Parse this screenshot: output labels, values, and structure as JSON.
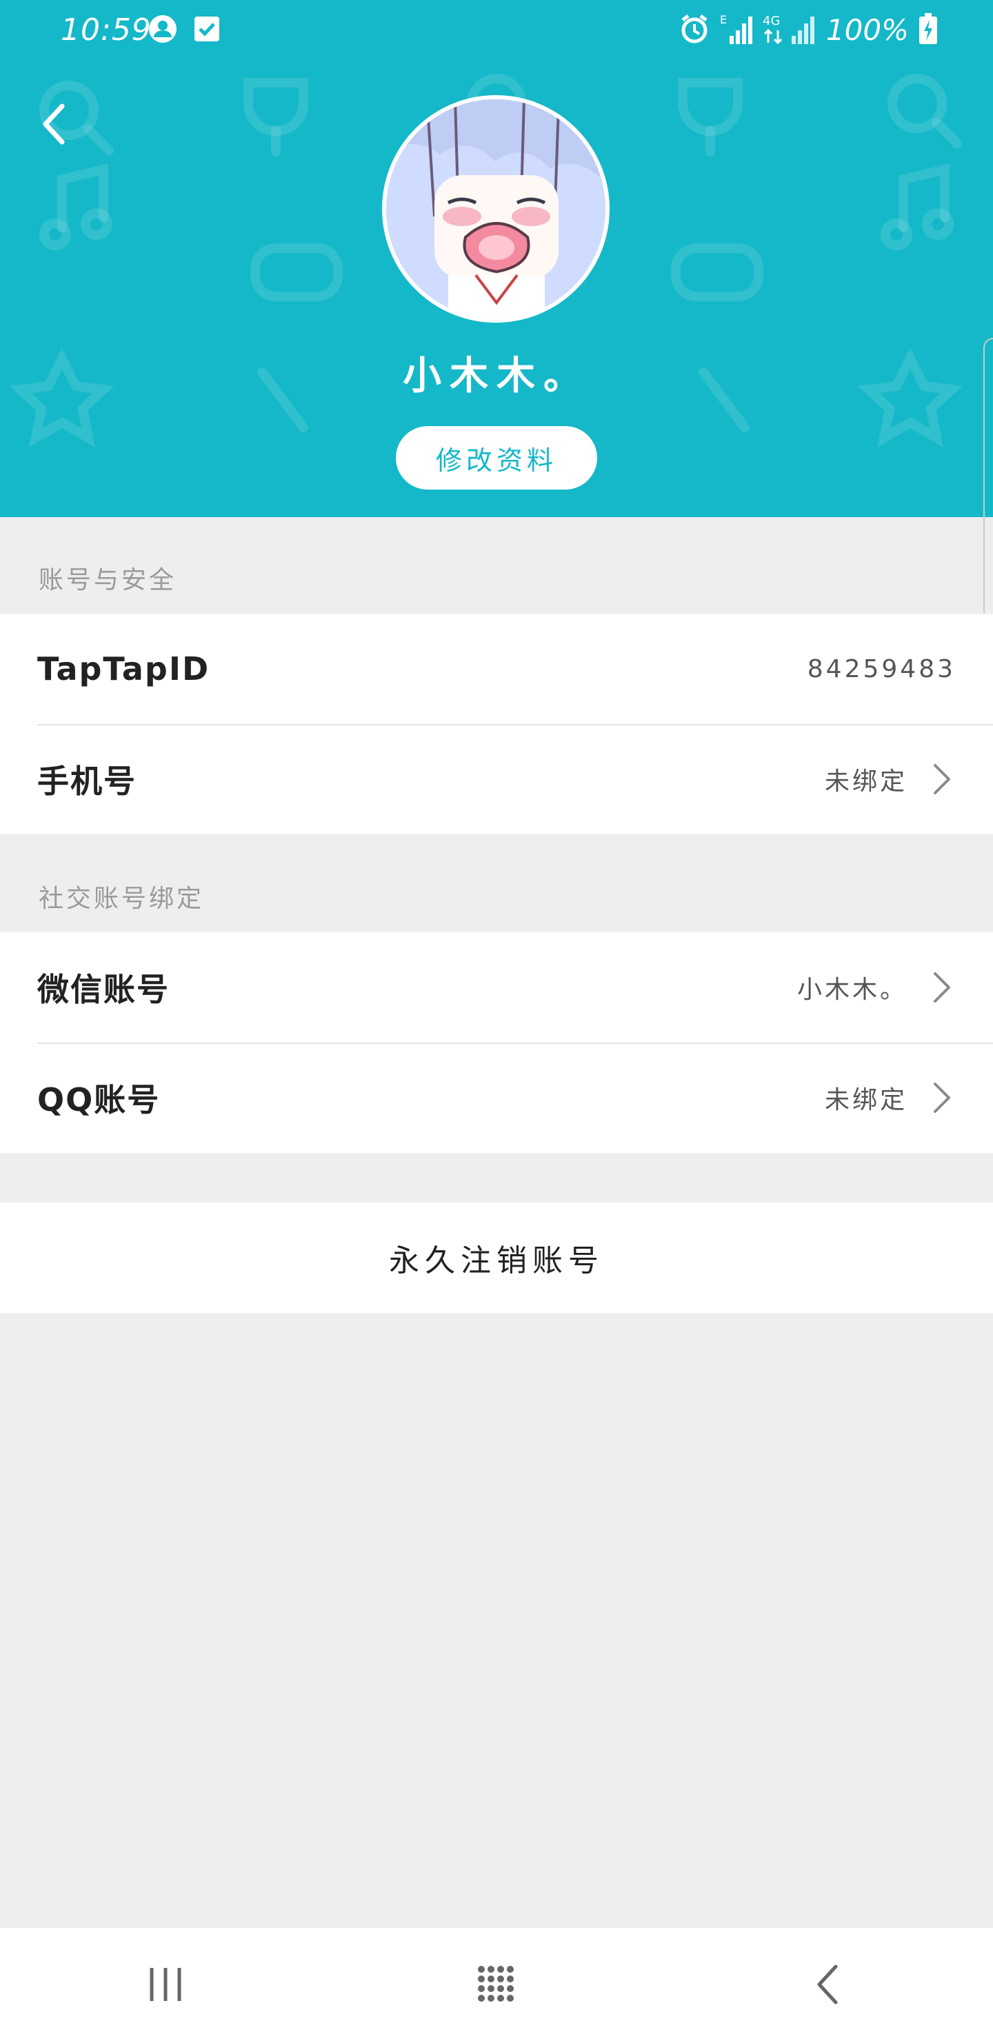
{
  "status_bar": {
    "time": "10:59",
    "battery": "100%",
    "network": "4G",
    "signal_label": "E",
    "icons": [
      "profile-icon",
      "checkbox-icon",
      "alarm-icon",
      "signal-icon",
      "battery-charging-icon"
    ]
  },
  "header": {
    "background_color": "#15b8c8",
    "nickname": "小木木。",
    "edit_button_label": "修改资料"
  },
  "sections": [
    {
      "title": "账号与安全",
      "rows": [
        {
          "label": "TapTapID",
          "value": "84259483",
          "chevron": false
        },
        {
          "label": "手机号",
          "value": "未绑定",
          "chevron": true
        }
      ]
    },
    {
      "title": "社交账号绑定",
      "rows": [
        {
          "label": "微信账号",
          "value": "小木木。",
          "chevron": true
        },
        {
          "label": "QQ账号",
          "value": "未绑定",
          "chevron": true
        }
      ]
    }
  ],
  "delete_account_label": "永久注销账号",
  "nav_bar": {
    "items": [
      "recent-apps-icon",
      "home-icon",
      "back-icon"
    ]
  }
}
